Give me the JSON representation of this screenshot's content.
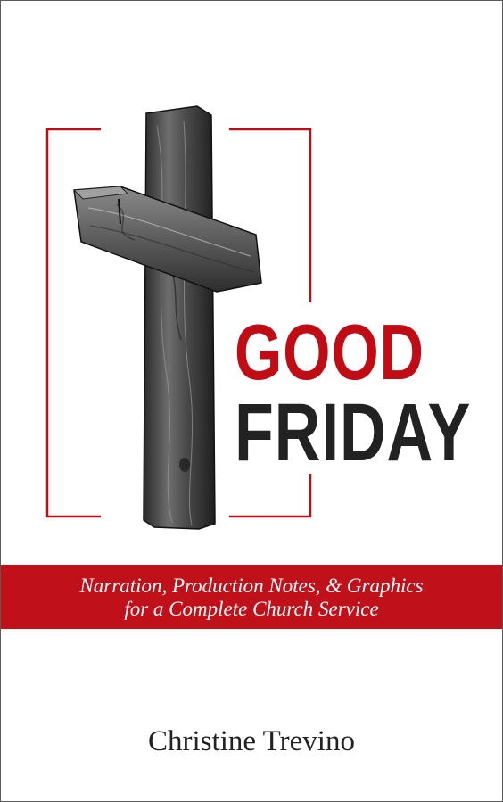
{
  "cover": {
    "title_line1": "GOOD",
    "title_line2": "FRIDAY",
    "subtitle_line1": "Narration, Production Notes, & Graphics",
    "subtitle_line2": "for a Complete Church Service",
    "author": "Christine Trevino"
  },
  "colors": {
    "accent_red": "#c00d15",
    "title_dark": "#222222",
    "band_red": "#c0101a",
    "background": "#ffffff"
  },
  "image": {
    "subject": "wooden-cross-icon"
  }
}
